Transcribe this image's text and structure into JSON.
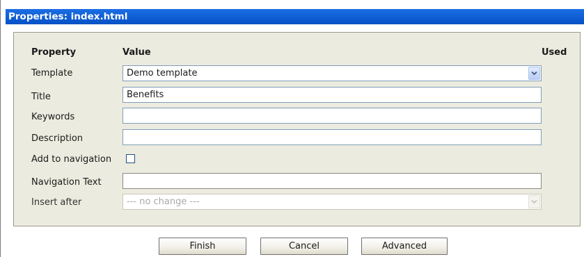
{
  "dialog": {
    "title": "Properties: index.html"
  },
  "table": {
    "headers": {
      "property": "Property",
      "value": "Value",
      "used": "Used"
    },
    "rows": [
      {
        "label": "Template",
        "value": "Demo template",
        "type": "select"
      },
      {
        "label": "Title",
        "value": "Benefits",
        "type": "text"
      },
      {
        "label": "Keywords",
        "value": "",
        "type": "text"
      },
      {
        "label": "Description",
        "value": "",
        "type": "text"
      },
      {
        "label": "Add to navigation",
        "checked": false,
        "type": "checkbox"
      },
      {
        "label": "Navigation Text",
        "value": "",
        "type": "text"
      },
      {
        "label": "Insert after",
        "value": "--- no change ---",
        "type": "select",
        "disabled": true
      }
    ]
  },
  "buttons": {
    "finish": "Finish",
    "cancel": "Cancel",
    "advanced": "Advanced"
  },
  "icons": {
    "dropdown": "chevron-down-icon"
  },
  "colors": {
    "titlebar": "#0a5fd6",
    "panel": "#ecebdf",
    "field_border": "#7f9db9"
  }
}
